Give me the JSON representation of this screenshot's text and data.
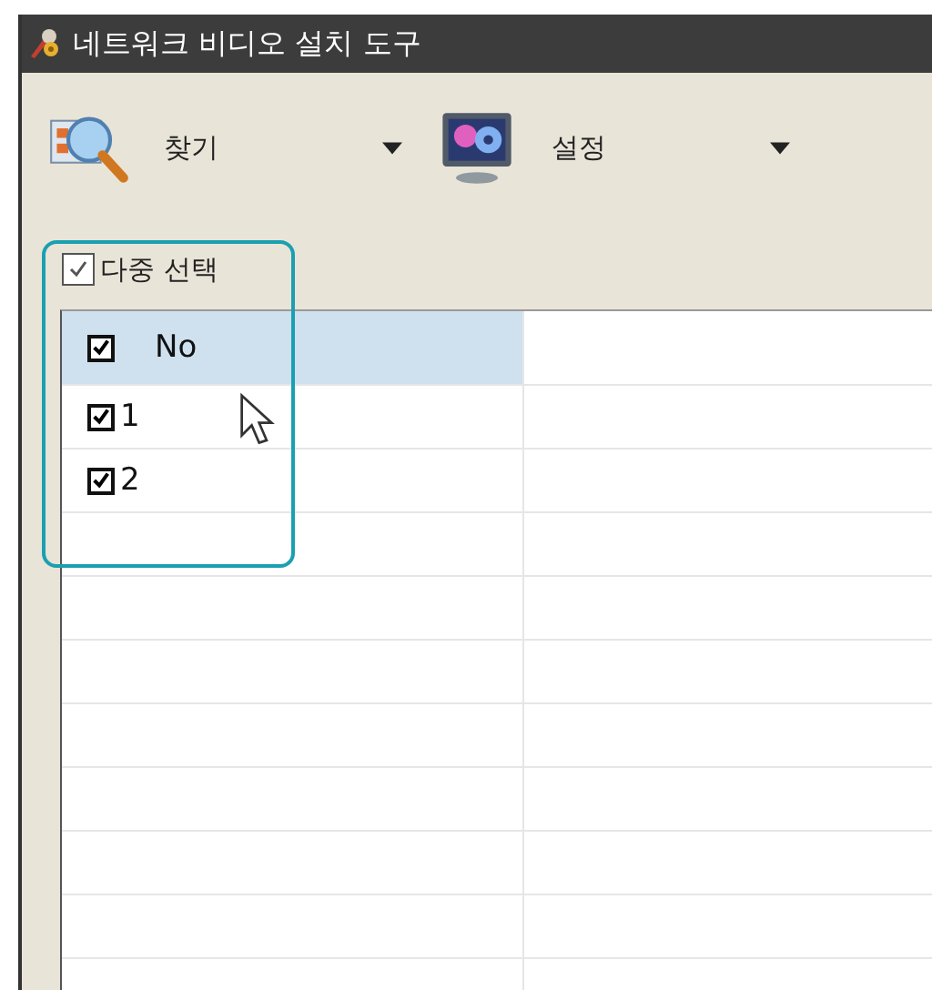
{
  "window": {
    "title": "네트워크 비디오 설치 도구"
  },
  "toolbar": [
    {
      "label": "찾기",
      "kind": "search"
    },
    {
      "label": "설정",
      "kind": "settings"
    }
  ],
  "multi_select": {
    "label": "다중 선택",
    "checked": true
  },
  "table": {
    "header": {
      "label": "No",
      "checked": true,
      "selected": true
    },
    "rows": [
      {
        "label": "1",
        "checked": true
      },
      {
        "label": "2",
        "checked": true
      }
    ]
  }
}
